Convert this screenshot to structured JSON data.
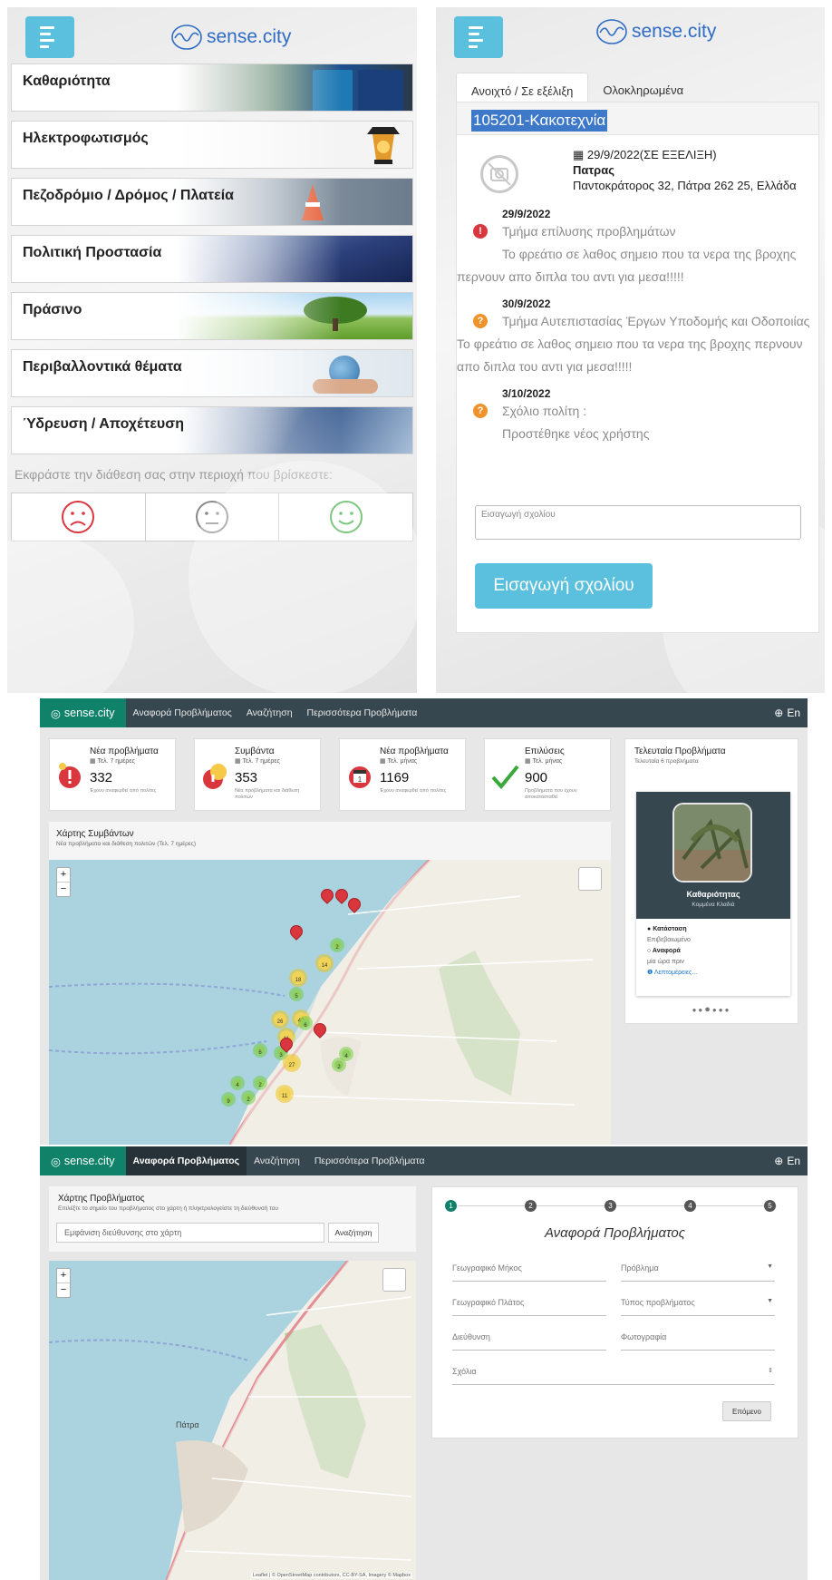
{
  "brand": {
    "name": "sense.city",
    "color": "#2f6cc5",
    "accent": "#5bc0de"
  },
  "mobile_categories": {
    "categories": [
      {
        "label": "Καθαριότητα"
      },
      {
        "label": "Ηλεκτροφωτισμός"
      },
      {
        "label": "Πεζοδρόμιο / Δρόμος / Πλατεία"
      },
      {
        "label": "Πολιτική Προστασία"
      },
      {
        "label": "Πράσινο"
      },
      {
        "label": "Περιβαλλοντικά θέματα"
      },
      {
        "label": "Ύδρευση / Αποχέτευση"
      }
    ],
    "mood_prompt": "Εκφράστε την διάθεση σας στην περιοχή που βρίσκεστε:",
    "moods": [
      "sad-face-icon",
      "neutral-face-icon",
      "happy-face-icon"
    ]
  },
  "mobile_issue": {
    "tabs": [
      "Ανοιχτό / Σε εξέλιξη",
      "Ολοκληρωμένα"
    ],
    "title": "105201-Κακοτεχνία",
    "date_status": "29/9/2022(ΣΕ ΕΞΕΛΙΞΗ)",
    "city": "Πατρας",
    "address": "Παντοκράτορος 32, Πάτρα 262 25, Ελλάδα",
    "timeline": [
      {
        "date": "29/9/2022",
        "status_color": "#d9363e",
        "dept": "Τμήμα επίλυσης προβλημάτων",
        "text": "Το φρεάτιο σε λαθος σημειο που τα νερα της βροχης περνουν απο διπλα του αντι για μεσα!!!!!"
      },
      {
        "date": "30/9/2022",
        "status_color": "#f0932b",
        "dept": "Τμήμα Αυτεπιστασίας Έργων Υποδομής και Οδοποιίας",
        "text": "Το φρεάτιο σε λαθος σημειο που τα νερα της βροχης περνουν απο διπλα του αντι για μεσα!!!!!"
      },
      {
        "date": "3/10/2022",
        "status_color": "#f0932b",
        "dept": "Σχόλιο πολίτη :",
        "text": "Προστέθηκε νέος χρήστης"
      }
    ],
    "comment_placeholder": "Εισαγωγή σχολίου",
    "comment_button": "Εισαγωγή σχολίου"
  },
  "nav": {
    "brand": "sense.city",
    "items": [
      "Αναφορά Προβλήματος",
      "Αναζήτηση",
      "Περισσότερα Προβλήματα"
    ],
    "lang": "En",
    "colors": {
      "bar": "#37474f",
      "brand_bg": "#11826a"
    }
  },
  "dashboard": {
    "stats": [
      {
        "title": "Νέα προβλήματα",
        "period": "Τελ. 7 ημέρες",
        "value": "332",
        "desc": "Έχουν αναφερθεί από πολίτες"
      },
      {
        "title": "Συμβάντα",
        "period": "Τελ. 7 ημέρες",
        "value": "353",
        "desc": "Νέα προβλήματα και διάθεση πολιτών"
      },
      {
        "title": "Νέα προβλήματα",
        "period": "Τελ. μήνας",
        "value": "1169",
        "desc": "Έχουν αναφερθεί από πολίτες"
      },
      {
        "title": "Επιλύσεις",
        "period": "Τελ. μήνας",
        "value": "900",
        "desc": "Προβλήματα που έχουν αποκατασταθεί"
      }
    ],
    "map_title": "Χάρτης Συμβάντων",
    "map_subtitle": "Νέα προβλήματα και διάθεση πολιτών (Τελ. 7 ημέρες)",
    "clusters": [
      "2",
      "14",
      "18",
      "5",
      "26",
      "42",
      "6",
      "11",
      "6",
      "3",
      "27",
      "4",
      "2",
      "4",
      "2",
      "11",
      "9",
      "2"
    ],
    "recent": {
      "title": "Τελευταία Προβλήματα",
      "subtitle": "Τελευταία 6 προβλήματα",
      "category": "Καθαριότητας",
      "category_sub": "Κομμένα Κλαδιά",
      "status_label": "Κατάσταση",
      "status_value": "Επιβεβαιωμένο",
      "report_label": "Αναφορά",
      "report_value": "μία ώρα πριν",
      "details": "Λεπτομέρειες..."
    }
  },
  "report": {
    "map_title": "Χάρτης Προβλήματος",
    "map_subtitle": "Επιλέξτε το σημείο του προβλήματος στο χάρτη ή πληκτρολογείστε τη διεύθυνσή του",
    "search_placeholder": "Εμφάνιση διεύθυνσης στο χάρτη",
    "search_button": "Αναζήτηση",
    "steps": [
      "1",
      "2",
      "3",
      "4",
      "5"
    ],
    "form_title": "Αναφορά Προβλήματος",
    "fields": {
      "lon": "Γεωγραφικό Μήκος",
      "problem": "Πρόβλημα",
      "lat": "Γεωγραφικό Πλάτος",
      "type": "Τύπος προβλήματος",
      "address": "Διεύθυνση",
      "photo": "Φωτογραφία",
      "comments": "Σχόλια"
    },
    "next_button": "Επόμενο",
    "map_city": "Πάτρα",
    "attribution": "Leaflet | © OpenStreetMap contributors, CC-BY-SA, Imagery © Mapbox"
  }
}
